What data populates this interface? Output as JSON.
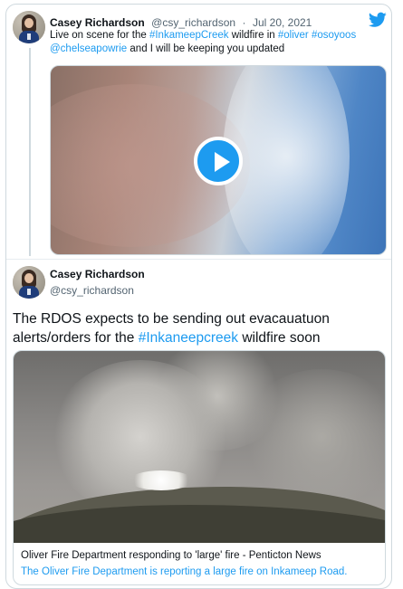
{
  "tweet1": {
    "author_name": "Casey Richardson",
    "handle": "@csy_richardson",
    "separator": "·",
    "date": "Jul 20, 2021",
    "text_parts": [
      {
        "t": "Live on scene for the ",
        "link": false
      },
      {
        "t": "#InkameepCreek",
        "link": true
      },
      {
        "t": " wildfire in ",
        "link": false
      },
      {
        "t": "#oliver",
        "link": true
      },
      {
        "t": " ",
        "link": false
      },
      {
        "t": "#osoyoos",
        "link": true
      },
      {
        "t": " ",
        "link": false
      },
      {
        "t": "@chelseapowrie",
        "link": true
      },
      {
        "t": " and I will be keeping you updated",
        "link": false
      }
    ],
    "media_icon": "play-icon"
  },
  "tweet2": {
    "author_name": "Casey Richardson",
    "handle": "@csy_richardson",
    "text_parts": [
      {
        "t": "The RDOS expects to be sending out evacauatuon alerts/orders for the ",
        "link": false
      },
      {
        "t": "#Inkaneepcreek",
        "link": true
      },
      {
        "t": " wildfire soon",
        "link": false
      }
    ],
    "link_card": {
      "title": "Oliver Fire Department responding to 'large' fire - Penticton News",
      "description": "The Oliver Fire Department is reporting a large fire on Inkameep Road."
    }
  },
  "brand_icon": "twitter-bird-icon",
  "colors": {
    "accent": "#1d9bf0",
    "text": "#0f1419",
    "secondary_text": "#536471",
    "border": "#cfd9de"
  }
}
